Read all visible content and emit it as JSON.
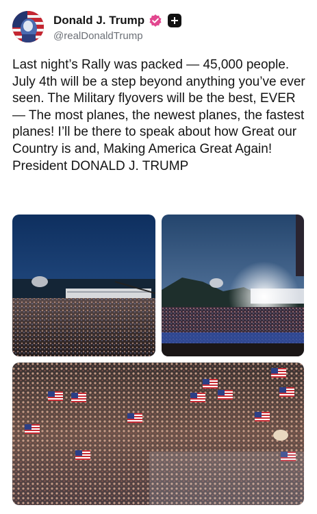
{
  "post": {
    "author": {
      "display_name": "Donald J. Trump",
      "handle": "@realDonaldTrump"
    },
    "text": "Last night’s Rally was packed — 45,000 people. July 4th will be a step beyond anything you’ve ever seen. The Military flyovers will be the best, EVER — The most planes, the newest planes, the fastest planes! I’ll be there to speak about how Great our Country is and, Making America Great Again! President DONALD J. TRUMP"
  },
  "icons": {
    "verified": "verified-badge-icon",
    "plus": "plus-icon"
  },
  "colors": {
    "verified_badge": "#e2478f",
    "text": "#141414",
    "handle": "#6b6f76"
  }
}
